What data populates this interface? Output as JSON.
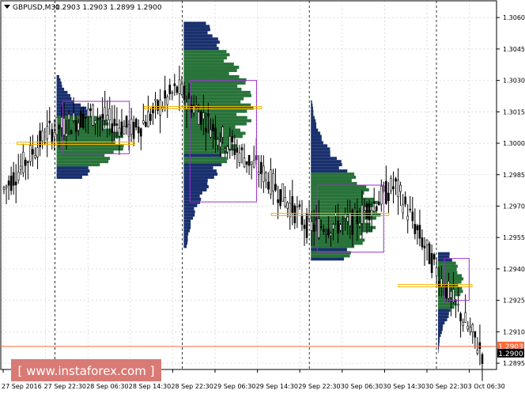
{
  "header": {
    "arrow_icon": "triangle-down-icon",
    "symbol_timeframe": "GBPUSD,M30",
    "ohlc": "1.2903 1.2903 1.2899 1.2900"
  },
  "watermark": {
    "text": "[ www.instaforex.com ]"
  },
  "colors": {
    "background": "#ffffff",
    "candle": "#000000",
    "profile_dark": "#0d2566",
    "profile_green": "#1c6b2e",
    "value_area_box": "#9a32cd",
    "poc_line": "#f5b400",
    "price_line": "#ff6a3a",
    "price_tag_bg": "#000000",
    "watermark_bg": "#d97a75"
  },
  "chart_data": {
    "type": "candlestick",
    "symbol": "GBPUSD",
    "timeframe": "M30",
    "ylim": [
      1.2892,
      1.3068
    ],
    "y_ticks": [
      "1.3060",
      "1.3045",
      "1.3030",
      "1.3015",
      "1.3000",
      "1.2985",
      "1.2970",
      "1.2955",
      "1.2940",
      "1.2925",
      "1.2910",
      "1.2895"
    ],
    "x_tick_labels": [
      "27 Sep 2016",
      "27 Sep 22:30",
      "28 Sep 06:30",
      "28 Sep 14:30",
      "28 Sep 22:30",
      "29 Sep 06:30",
      "29 Sep 14:30",
      "29 Sep 22:30",
      "30 Sep 06:30",
      "30 Sep 14:30",
      "30 Sep 22:30",
      "3 Oct 06:30"
    ],
    "day_separators": [
      "27 Sep 22:30",
      "28 Sep 22:30",
      "29 Sep 22:30",
      "30 Sep 22:30"
    ],
    "price_labels": {
      "current_close": "1.2900",
      "bid_line": "1.2903"
    },
    "volume_profiles": [
      {
        "session": "27 Sep",
        "poc": 1.3,
        "value_area": [
          1.2995,
          1.302
        ],
        "range": [
          1.2983,
          1.3032
        ]
      },
      {
        "session": "28 Sep",
        "poc": 1.3017,
        "value_area": [
          1.2972,
          1.303
        ],
        "range": [
          1.295,
          1.3058
        ]
      },
      {
        "session": "29 Sep",
        "poc": 1.2966,
        "value_area": [
          1.2948,
          1.298
        ],
        "range": [
          1.2944,
          1.302
        ]
      },
      {
        "session": "30 Sep",
        "poc": 1.2932,
        "value_area": [
          1.2925,
          1.2945
        ],
        "range": [
          1.29,
          1.2947
        ]
      }
    ],
    "candles_sampled": [
      {
        "t": "27 Sep 2016",
        "close": 1.2978
      },
      {
        "t": "27 Sep 22:30",
        "close": 1.3005
      },
      {
        "t": "28 Sep 06:30",
        "close": 1.3014
      },
      {
        "t": "28 Sep 14:30",
        "close": 1.3006
      },
      {
        "t": "28 Sep 22:30",
        "close": 1.3026
      },
      {
        "t": "29 Sep 06:30",
        "close": 1.3003
      },
      {
        "t": "29 Sep 14:30",
        "close": 1.2985
      },
      {
        "t": "29 Sep 22:30",
        "close": 1.296
      },
      {
        "t": "30 Sep 06:30",
        "close": 1.2962
      },
      {
        "t": "30 Sep 14:30",
        "close": 1.298
      },
      {
        "t": "30 Sep 22:30",
        "close": 1.2937
      },
      {
        "t": "3 Oct 06:30",
        "close": 1.29
      }
    ]
  }
}
